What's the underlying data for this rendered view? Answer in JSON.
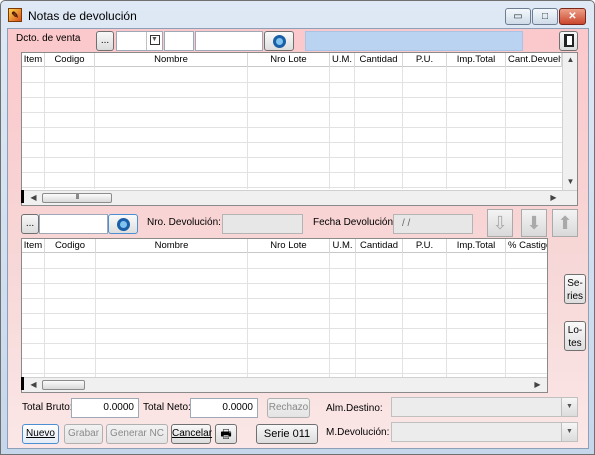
{
  "window": {
    "title": "Notas de devolución",
    "icon": "document-edit-icon",
    "controls": {
      "minimize": "▭",
      "maximize": "□",
      "close": "✕"
    }
  },
  "top": {
    "dcto_label": "Dcto. de venta",
    "browse_label": "...",
    "combo_value": "",
    "field1_value": "",
    "field2_value": "",
    "search_icon": "search-icon",
    "info_value": "",
    "exit_icon": "exit-door-icon"
  },
  "grid1": {
    "columns": [
      "Item",
      "Codigo",
      "Nombre",
      "Nro Lote",
      "U.M.",
      "Cantidad",
      "P.U.",
      "Imp.Total",
      "Cant.Devuelta"
    ],
    "rows": [],
    "scroll_thumb": "III"
  },
  "middle": {
    "browse_label": "...",
    "field_value": "",
    "search_icon": "search-icon",
    "nro_devolucion_label": "Nro. Devolución:",
    "nro_devolucion_value": "",
    "fecha_devolucion_label": "Fecha Devolución",
    "fecha_devolucion_value": "/ /",
    "arrow_down_outline": "⇩",
    "arrow_down": "⬇",
    "arrow_up": "⬆"
  },
  "grid2": {
    "columns": [
      "Item",
      "Codigo",
      "Nombre",
      "Nro Lote",
      "U.M.",
      "Cantidad",
      "P.U.",
      "Imp.Total",
      "% Castigo"
    ],
    "rows": [],
    "scroll_thumb": ""
  },
  "side": {
    "series_label_1": "Se-",
    "series_label_2": "ries",
    "lotes_label_1": "Lo-",
    "lotes_label_2": "tes"
  },
  "bottom": {
    "total_bruto_label": "Total Bruto:",
    "total_bruto_value": "0.0000",
    "total_neto_label": "Total Neto:",
    "total_neto_value": "0.0000",
    "rechazo_label": "Rechazo",
    "alm_destino_label": "Alm.Destino:",
    "alm_destino_value": "",
    "nuevo_label": "Nuevo",
    "grabar_label": "Grabar",
    "generar_nc_label": "Generar NC",
    "cancelar_label": "Cancelar",
    "print_icon": "printer-icon",
    "serie_label": "Serie 011",
    "m_devolucion_label": "M.Devolución:",
    "m_devolucion_value": ""
  }
}
